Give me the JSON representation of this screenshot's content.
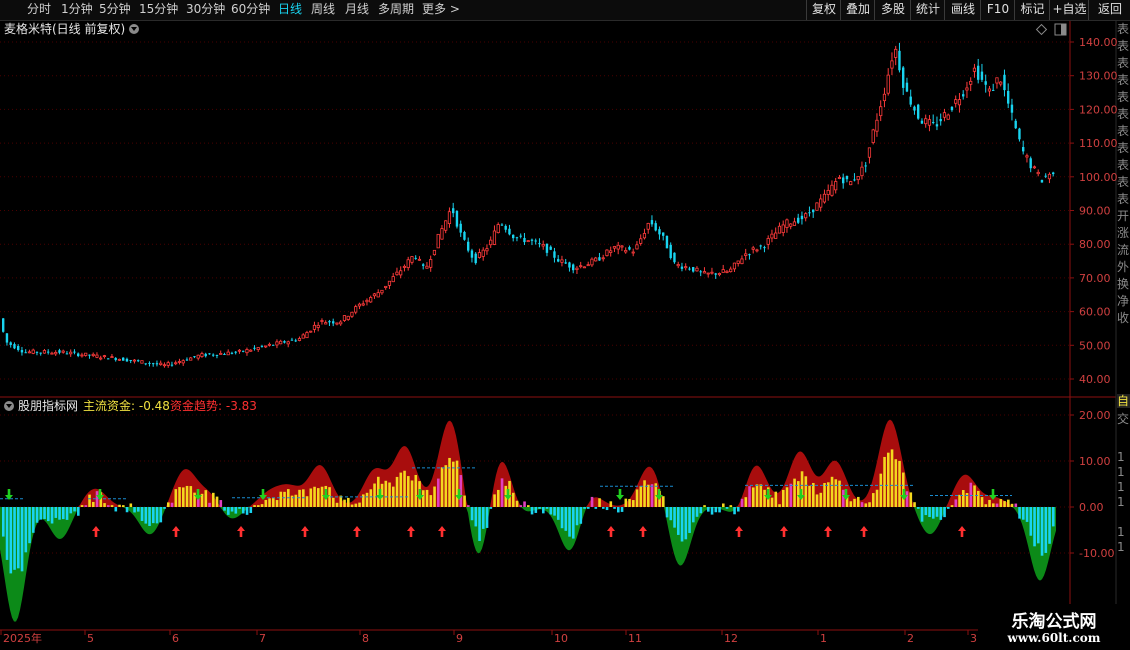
{
  "period_tabs": [
    {
      "label": "分时",
      "active": false
    },
    {
      "label": "1分钟",
      "active": false
    },
    {
      "label": "5分钟",
      "active": false
    },
    {
      "label": "15分钟",
      "active": false
    },
    {
      "label": "30分钟",
      "active": false
    },
    {
      "label": "60分钟",
      "active": false
    },
    {
      "label": "日线",
      "active": true
    },
    {
      "label": "周线",
      "active": false
    },
    {
      "label": "月线",
      "active": false
    },
    {
      "label": "多周期",
      "active": false
    },
    {
      "label": "更多 >",
      "active": false
    }
  ],
  "toolbar": [
    "复权",
    "叠加",
    "多股",
    "统计",
    "画线",
    "F10",
    "标记",
    "+自选",
    "返回"
  ],
  "stock_title": "麦格米特(日线 前复权)",
  "indicator": {
    "name": "股朋指标网",
    "items": [
      {
        "label": "主流资金: -0.48",
        "color": "#f0e040"
      },
      {
        "label": "资金趋势: -3.83",
        "color": "#ff3030"
      }
    ]
  },
  "main_axis_labels": [
    "140.00",
    "130.00",
    "120.00",
    "110.00",
    "100.00",
    "90.00",
    "80.00",
    "70.00",
    "60.00",
    "50.00",
    "40.00"
  ],
  "sub_axis_labels": [
    "20.00",
    "10.00",
    "0.00",
    "-10.00"
  ],
  "date_labels": [
    "2025年",
    "5",
    "6",
    "7",
    "8",
    "9",
    "10",
    "11",
    "12",
    "1",
    "2",
    "3"
  ],
  "right_strip_chars": [
    "表",
    "表",
    "表",
    "表",
    "表",
    "表",
    "表",
    "表",
    "表",
    "表",
    "表",
    "开",
    "涨",
    "流",
    "外",
    "换",
    "净",
    "收",
    "",
    "自",
    "交",
    "1",
    "1",
    "1",
    "1",
    "1",
    "1"
  ],
  "watermark": {
    "title": "乐淘公式网",
    "url": "www.60lt.com"
  },
  "colors": {
    "up": "#ff3b3b",
    "down": "#19d4f0",
    "gridline": "#4a0000",
    "axis": "#8c1010",
    "positive_area": "#a80d0d",
    "negative_area": "#0c8a18",
    "yellow": "#f4d81e",
    "magenta": "#e040c0",
    "cyan": "#19d4f0"
  },
  "icons": [
    "collapse-circle-icon",
    "diamond-icon",
    "window-icon",
    "up-arrow-icon",
    "down-arrow-icon"
  ]
}
